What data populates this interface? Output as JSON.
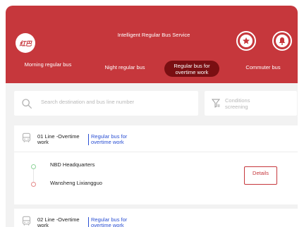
{
  "header": {
    "logo_text": "红巴",
    "title": "Intelligent Regular Bus Service",
    "background": "#c6373c",
    "favorites_icon": "star-icon",
    "notifications_icon": "bell-icon"
  },
  "tabs": [
    {
      "label": "Morning regular bus",
      "active": false
    },
    {
      "label": "Night regular bus",
      "active": false
    },
    {
      "label": "Regular bus for overtime work",
      "active": true
    },
    {
      "label": "Commuter bus",
      "active": false
    }
  ],
  "search": {
    "placeholder": "Search destination and bus line number"
  },
  "conditions": {
    "label": "Conditions screening"
  },
  "routes": [
    {
      "name": "01 Line -Overtime work",
      "type": "Regular bus for overtime work",
      "start_stop": "NBD Headquarters",
      "end_stop": "Wansheng Lixiangguo",
      "details_label": "Details"
    },
    {
      "name": "02 Line -Overtime work",
      "type": "Regular bus for overtime work"
    }
  ],
  "colors": {
    "accent": "#c6373c",
    "active_tab": "#7a0f12",
    "link_blue": "#2a4fd3"
  }
}
